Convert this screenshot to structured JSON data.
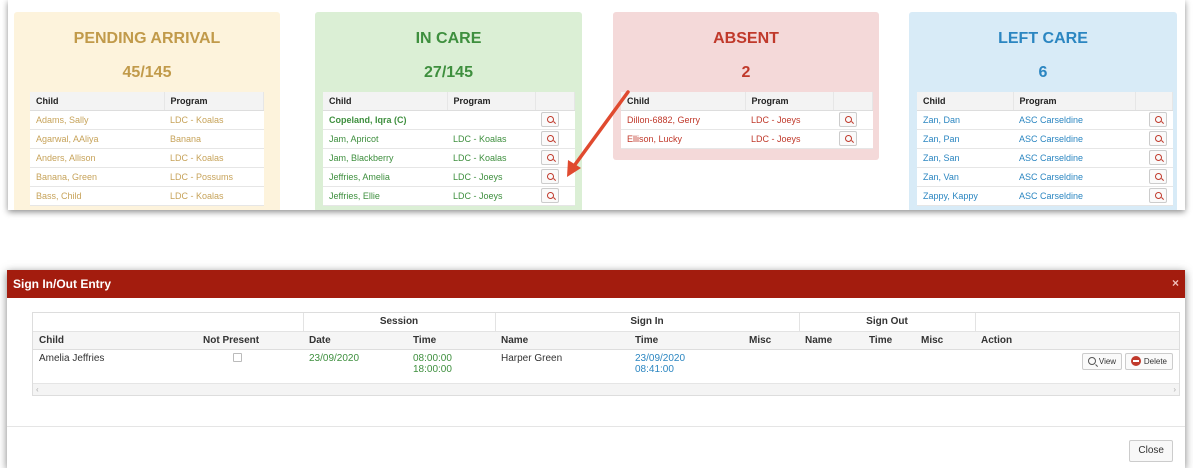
{
  "dashboard": {
    "pending": {
      "title": "PENDING ARRIVAL",
      "count": "45/145",
      "headers": [
        "Child",
        "Program"
      ],
      "rows": [
        {
          "child": "Adams, Sally",
          "program": "LDC - Koalas"
        },
        {
          "child": "Agarwal, AAliya",
          "program": "Banana"
        },
        {
          "child": "Anders, Allison",
          "program": "LDC - Koalas"
        },
        {
          "child": "Banana, Green",
          "program": "LDC - Possums"
        },
        {
          "child": "Bass, Child",
          "program": "LDC - Koalas"
        }
      ]
    },
    "incare": {
      "title": "IN CARE",
      "count": "27/145",
      "headers": [
        "Child",
        "Program"
      ],
      "rows": [
        {
          "child": "Copeland, Iqra (C)",
          "program": ""
        },
        {
          "child": "Jam, Apricot",
          "program": "LDC - Koalas"
        },
        {
          "child": "Jam, Blackberry",
          "program": "LDC - Koalas"
        },
        {
          "child": "Jeffries, Amelia",
          "program": "LDC - Joeys"
        },
        {
          "child": "Jeffries, Ellie",
          "program": "LDC - Joeys"
        }
      ]
    },
    "absent": {
      "title": "ABSENT",
      "count": "2",
      "headers": [
        "Child",
        "Program"
      ],
      "rows": [
        {
          "child": "Dillon-6882, Gerry",
          "program": "LDC - Joeys"
        },
        {
          "child": "Ellison, Lucky",
          "program": "LDC - Joeys"
        }
      ]
    },
    "left": {
      "title": "LEFT CARE",
      "count": "6",
      "headers": [
        "Child",
        "Program"
      ],
      "rows": [
        {
          "child": "Zan, Dan",
          "program": "ASC Carseldine"
        },
        {
          "child": "Zan, Pan",
          "program": "ASC Carseldine"
        },
        {
          "child": "Zan, San",
          "program": "ASC Carseldine"
        },
        {
          "child": "Zan, Van",
          "program": "ASC Carseldine"
        },
        {
          "child": "Zappy, Kappy",
          "program": "ASC Carseldine"
        }
      ]
    },
    "colors": {
      "pending": "#c7a35a",
      "incare": "#3e8f3e",
      "absent": "#c0392b",
      "left": "#2b86c1",
      "arrow": "#e04a2f"
    }
  },
  "modal": {
    "title": "Sign In/Out Entry",
    "close_x": "×",
    "groups": {
      "session": "Session",
      "sign_in": "Sign In",
      "sign_out": "Sign Out"
    },
    "headers": [
      "Child",
      "Not Present",
      "Date",
      "Time",
      "Name",
      "Time",
      "Misc",
      "Name",
      "Time",
      "Misc",
      "Action"
    ],
    "row": {
      "child": "Amelia Jeffries",
      "date": "23/09/2020",
      "time_start": "08:00:00",
      "time_end": "18:00:00",
      "sign_in_name": "Harper Green",
      "sign_in_date": "23/09/2020",
      "sign_in_time": "08:41:00",
      "view_label": "View",
      "delete_label": "Delete"
    },
    "scroll_left": "‹",
    "scroll_right": "›",
    "close_button": "Close",
    "header_color": "#a31c0e"
  }
}
